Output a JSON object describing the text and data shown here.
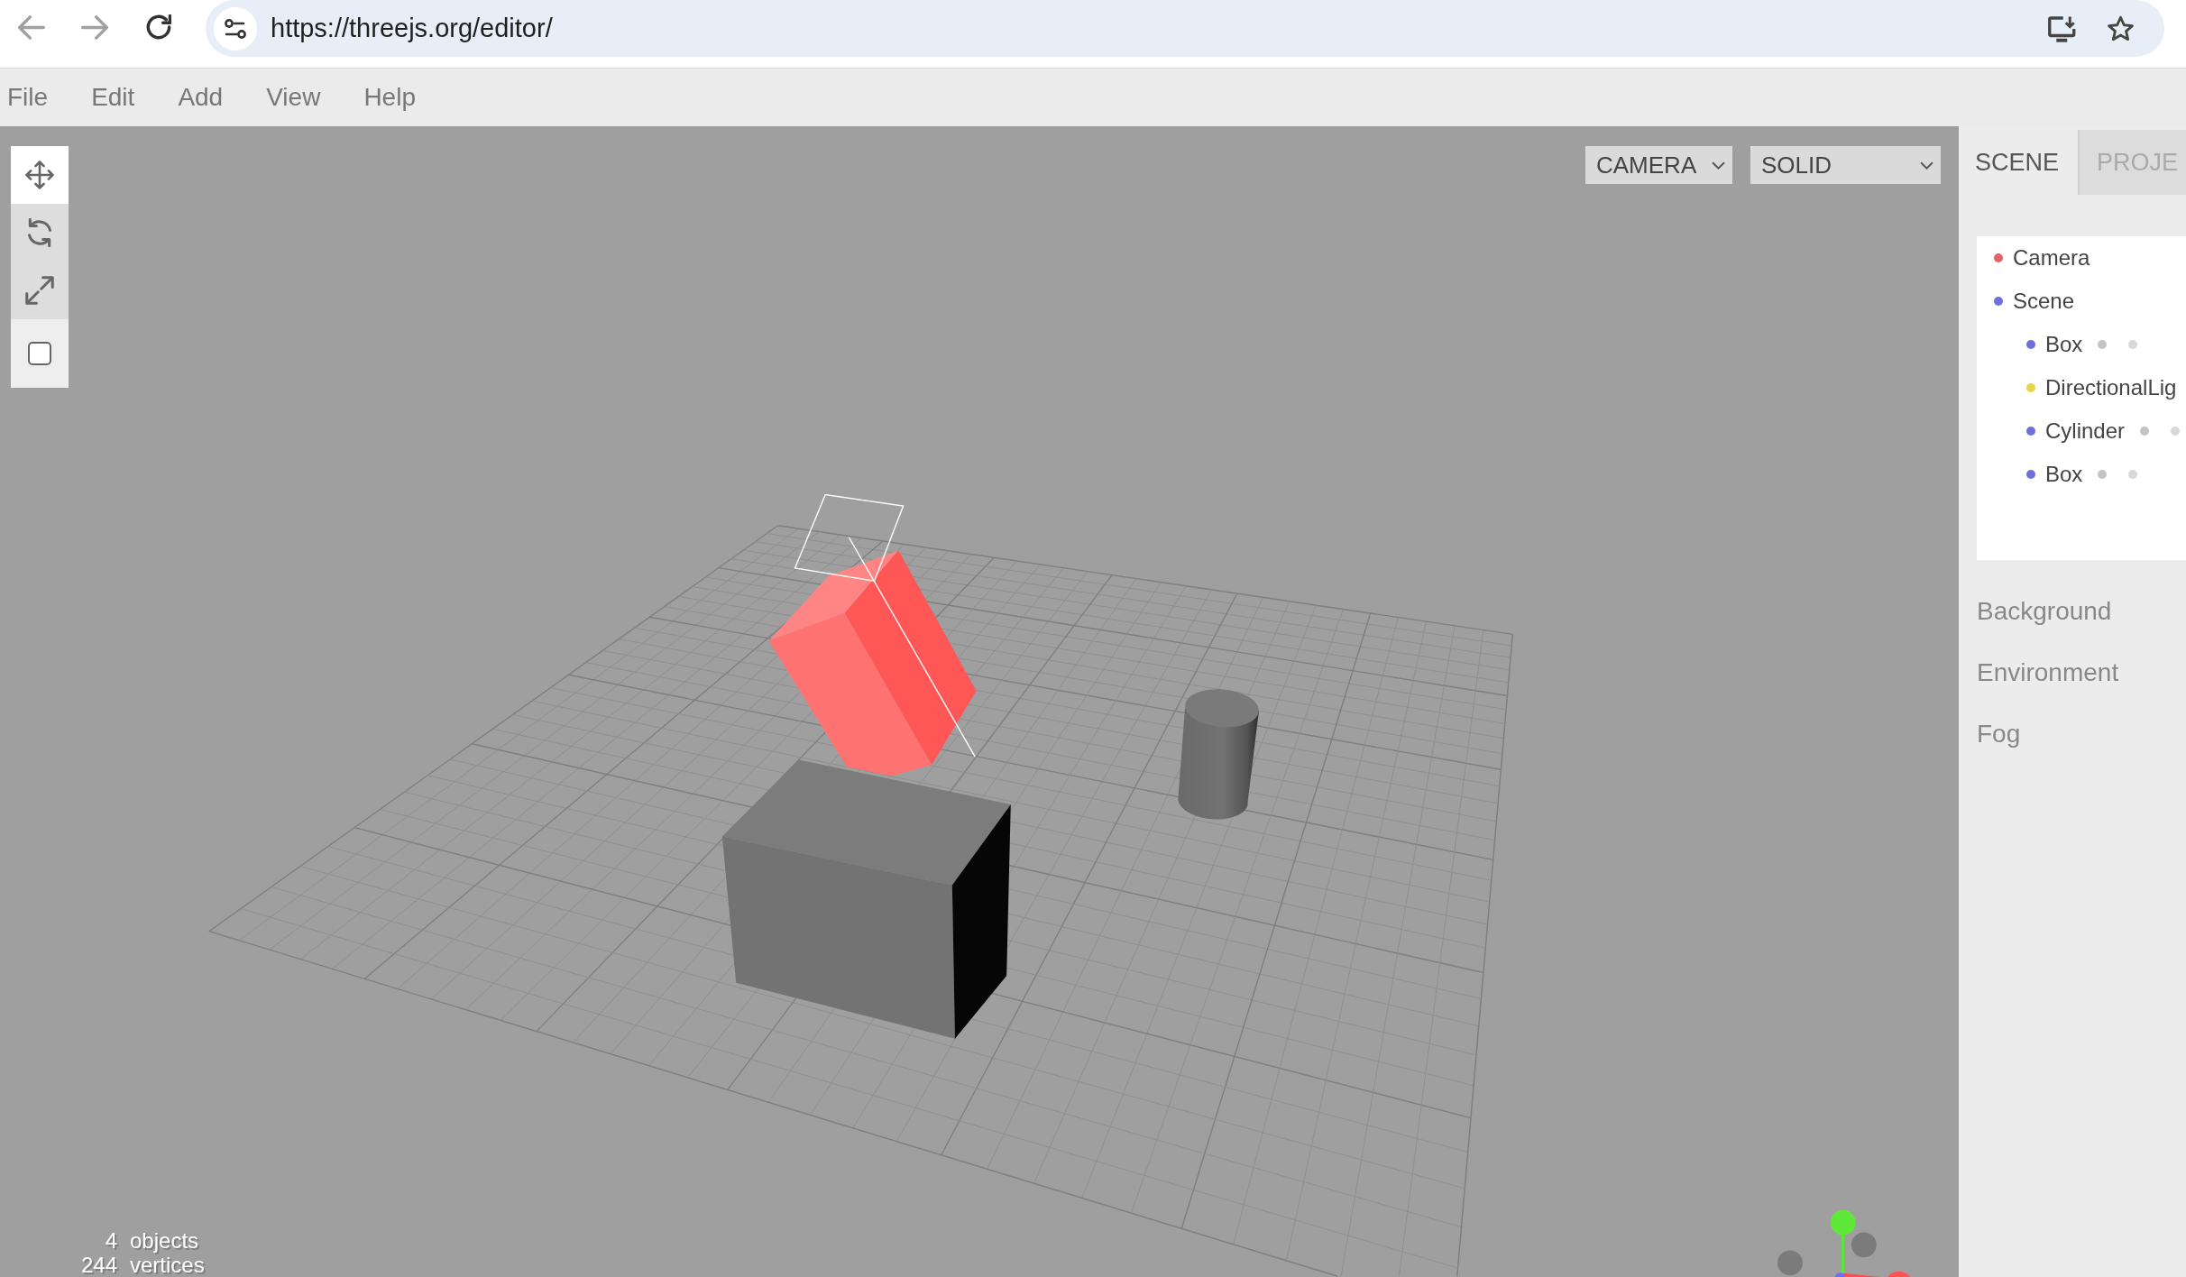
{
  "browser": {
    "back": {
      "disabled": true
    },
    "forward": {
      "disabled": true
    },
    "url": "https://threejs.org/editor/"
  },
  "menubar": [
    "File",
    "Edit",
    "Add",
    "View",
    "Help"
  ],
  "viewport": {
    "transform_tools": [
      {
        "selected": true
      },
      {
        "selected": false
      },
      {
        "selected": false
      }
    ],
    "local_space": {
      "checked": false
    },
    "camera_select": {
      "value": "CAMERA"
    },
    "shading_select": {
      "value": "SOLID"
    },
    "stats": [
      {
        "count": "4",
        "unit": "objects"
      },
      {
        "count": "244",
        "unit": "vertices"
      }
    ]
  },
  "sidebar": {
    "tabs": [
      {
        "label": "SCENE",
        "selected": true
      },
      {
        "label": "PROJE",
        "selected": false
      }
    ],
    "outliner": [
      {
        "label": "Camera",
        "color": "#e06666",
        "kind": "object"
      },
      {
        "label": "Scene",
        "color": "#6f6fe0",
        "kind": "object",
        "children": [
          {
            "label": "Box",
            "color": "#6f6fe0",
            "kind": "mesh"
          },
          {
            "label": "DirectionalLig",
            "color": "#e8d444",
            "kind": "object"
          },
          {
            "label": "Cylinder",
            "color": "#6f6fe0",
            "kind": "mesh"
          },
          {
            "label": "Box",
            "color": "#6f6fe0",
            "kind": "mesh"
          }
        ]
      }
    ],
    "properties": [
      "Background",
      "Environment",
      "Fog"
    ]
  }
}
